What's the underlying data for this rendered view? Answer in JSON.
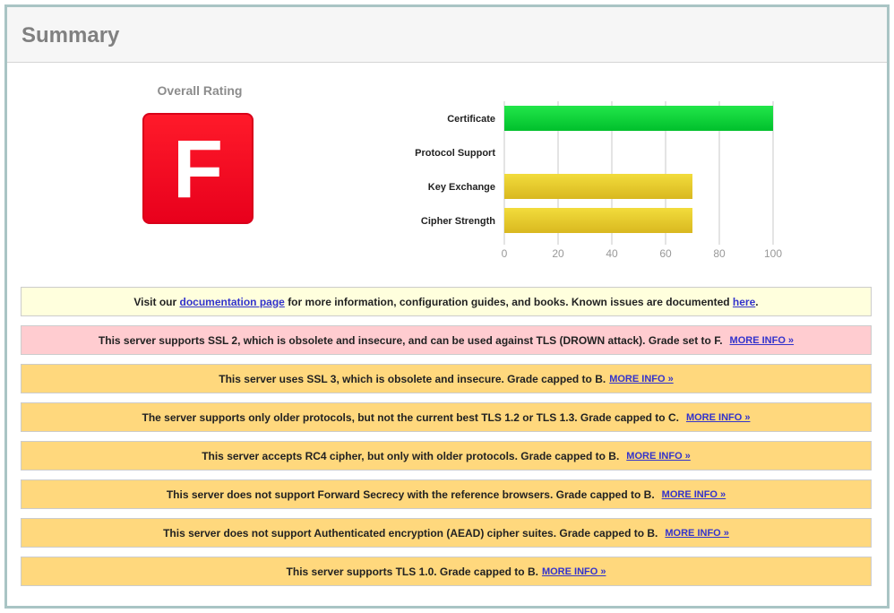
{
  "summary": {
    "title": "Summary"
  },
  "rating": {
    "label": "Overall Rating",
    "grade": "F",
    "grade_color": "#ff1a2a"
  },
  "chart_data": {
    "type": "bar",
    "orientation": "horizontal",
    "categories": [
      "Certificate",
      "Protocol Support",
      "Key Exchange",
      "Cipher Strength"
    ],
    "values": [
      100,
      0,
      70,
      70
    ],
    "colors": [
      "#00cc33",
      "#00cc33",
      "#e6c82b",
      "#e6c82b"
    ],
    "xlim": [
      0,
      100
    ],
    "ticks": [
      0,
      20,
      40,
      60,
      80,
      100
    ],
    "grid": true,
    "title": "",
    "xlabel": "",
    "ylabel": ""
  },
  "notices": [
    {
      "type": "info",
      "pre": "Visit our ",
      "link1": "documentation page",
      "mid": " for more information, configuration guides, and books. Known issues are documented ",
      "link2": "here",
      "post": "."
    },
    {
      "type": "error",
      "text": "This server supports SSL 2, which is obsolete and insecure, and can be used against TLS (DROWN attack). Grade set to F.",
      "more": "MORE INFO »"
    },
    {
      "type": "caution",
      "text": "This server uses SSL 3, which is obsolete and insecure. Grade capped to B.",
      "more": "MORE INFO »"
    },
    {
      "type": "caution",
      "text": "The server supports only older protocols, but not the current best TLS 1.2 or TLS 1.3. Grade capped to C.",
      "more": "MORE INFO »"
    },
    {
      "type": "caution",
      "text": "This server accepts RC4 cipher, but only with older protocols. Grade capped to B.",
      "more": "MORE INFO »"
    },
    {
      "type": "caution",
      "text": "This server does not support Forward Secrecy with the reference browsers. Grade capped to B.",
      "more": "MORE INFO »"
    },
    {
      "type": "caution",
      "text": "This server does not support Authenticated encryption (AEAD) cipher suites. Grade capped to B.",
      "more": "MORE INFO »"
    },
    {
      "type": "caution",
      "text": "This server supports TLS 1.0. Grade capped to B.",
      "more": "MORE INFO »"
    }
  ]
}
